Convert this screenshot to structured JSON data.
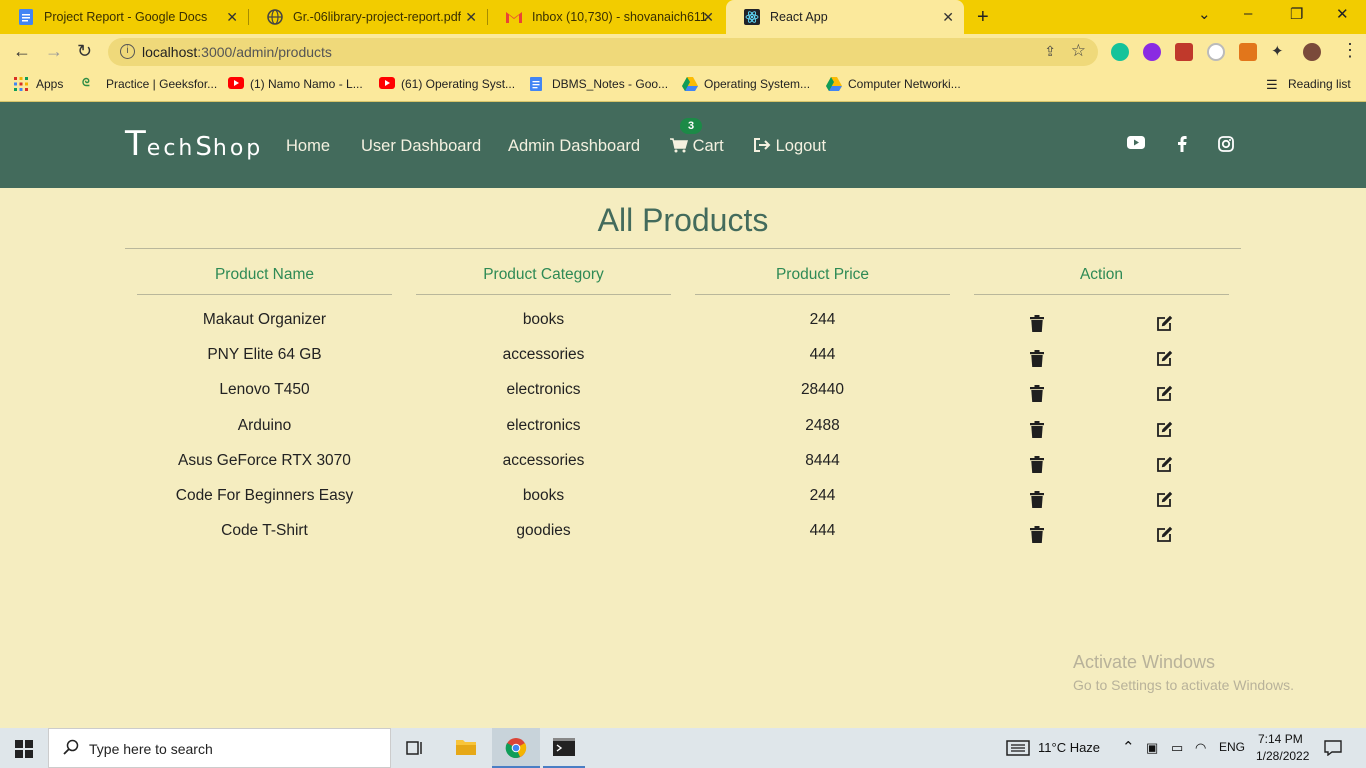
{
  "browser": {
    "tabs": [
      {
        "title": "Project Report - Google Docs",
        "icon": "google-docs-icon",
        "color": "#4285f4"
      },
      {
        "title": "Gr.-06library-project-report.pdf",
        "icon": "globe-icon"
      },
      {
        "title": "Inbox (10,730) - shovanaich611@",
        "icon": "gmail-icon"
      },
      {
        "title": "React App",
        "icon": "react-icon"
      }
    ],
    "url_host": "localhost",
    "url_path": ":3000/admin/products",
    "bookmarks": [
      {
        "label": "Apps",
        "icon": "apps-grid-icon"
      },
      {
        "label": "Practice | GeeksforGeeks",
        "display": "Practice | Geeksfor...",
        "icon": "gfg-icon"
      },
      {
        "label": "(1) Namo Namo - L...",
        "icon": "youtube-icon"
      },
      {
        "label": "(61) Operating Syst...",
        "icon": "youtube-icon"
      },
      {
        "label": "DBMS_Notes - Goo...",
        "icon": "google-docs-icon"
      },
      {
        "label": "Operating System...",
        "icon": "google-drive-icon"
      },
      {
        "label": "Computer Networki...",
        "icon": "google-drive-icon"
      }
    ],
    "reading_list": "Reading list"
  },
  "app": {
    "brand_first": "T",
    "brand_rest1": "ech",
    "brand_mid": "S",
    "brand_rest2": "hop",
    "nav": {
      "home": "Home",
      "user_dashboard": "User Dashboard",
      "admin_dashboard": "Admin Dashboard",
      "cart": "Cart",
      "cart_count": "3",
      "logout": "Logout"
    },
    "accent": "#436b5c"
  },
  "main": {
    "title": "All Products",
    "headers": {
      "name": "Product Name",
      "category": "Product Category",
      "price": "Product Price",
      "action": "Action"
    },
    "rows": [
      {
        "name": "Makaut Organizer",
        "category": "books",
        "price": "244"
      },
      {
        "name": "PNY Elite 64 GB",
        "category": "accessories",
        "price": "444"
      },
      {
        "name": "Lenovo T450",
        "category": "electronics",
        "price": "28440"
      },
      {
        "name": "Arduino",
        "category": "electronics",
        "price": "2488"
      },
      {
        "name": "Asus GeForce RTX 3070",
        "category": "accessories",
        "price": "8444"
      },
      {
        "name": "Code For Beginners Easy",
        "category": "books",
        "price": "244"
      },
      {
        "name": "Code T-Shirt",
        "category": "goodies",
        "price": "444"
      }
    ]
  },
  "watermark": {
    "line1": "Activate Windows",
    "line2": "Go to Settings to activate Windows."
  },
  "taskbar": {
    "search_placeholder": "Type here to search",
    "weather": "11°C  Haze",
    "lang": "ENG",
    "time": "7:14 PM",
    "date": "1/28/2022"
  }
}
